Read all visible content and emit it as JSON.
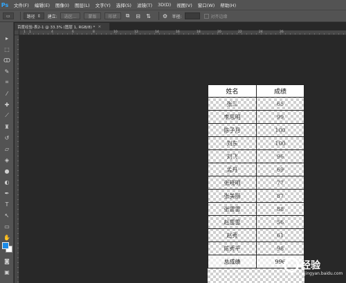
{
  "app": {
    "logo": "Ps"
  },
  "menu": [
    "文件(F)",
    "编辑(E)",
    "图像(I)",
    "图层(L)",
    "文字(Y)",
    "选择(S)",
    "滤镜(T)",
    "3D(D)",
    "视图(V)",
    "窗口(W)",
    "帮助(H)"
  ],
  "options": {
    "mode_value": "路径",
    "make_label": "建立:",
    "selection_btn": "选区...",
    "mask_btn": "蒙版",
    "shape_btn": "形状",
    "radius_label": "半径:",
    "radius_value": "",
    "align_edges_label": "对齐边缘"
  },
  "document_tab": {
    "title": "百度经验-表2-1 @ 33.3% (图层 1, RGB/8) *",
    "close": "×"
  },
  "ruler": {
    "top_labels": [
      "1",
      "1",
      "4",
      "6",
      "8",
      "10",
      "12",
      "14",
      "16",
      "18",
      "20",
      "22",
      "24",
      "26"
    ]
  },
  "table": {
    "headers": [
      "姓名",
      "成绩"
    ],
    "rows": [
      [
        "张三",
        "65"
      ],
      [
        "李思明",
        "99"
      ],
      [
        "陈子月",
        "100"
      ],
      [
        "刘东",
        "100"
      ],
      [
        "刘飞",
        "96"
      ],
      [
        "孟丹",
        "69"
      ],
      [
        "张晓明",
        "77"
      ],
      [
        "张美丽",
        "87"
      ],
      [
        "张雷雷",
        "88"
      ],
      [
        "赵雷雷",
        "56"
      ],
      [
        "赵秀",
        "61"
      ],
      [
        "陈秀平",
        "98"
      ]
    ],
    "total": [
      "总成绩",
      "996"
    ]
  },
  "watermark": {
    "text": "经验",
    "sub": "jingyan.baidu.com"
  },
  "colors": {
    "foreground": "#1a8ae6",
    "background": "#ffffff",
    "accent": "#31a8ff"
  }
}
